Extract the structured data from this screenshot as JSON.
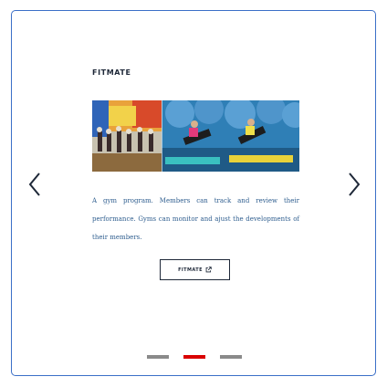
{
  "card": {
    "title": "FITMATE",
    "image_alt": "Fitness class members doing exercises with gym balls",
    "description": "A gym program. Members can track and review their performance. Gyms can monitor and ajust the developments of their members.",
    "button_label": "FITMATE",
    "button_icon": "external-link-icon"
  },
  "navigation": {
    "prev_icon": "chevron-left-icon",
    "next_icon": "chevron-right-icon"
  },
  "pagination": {
    "total": 3,
    "active_index": 1
  },
  "colors": {
    "card_border": "#3b6fc7",
    "title": "#1e2838",
    "description": "#2f5e8f",
    "dot_inactive": "#8a8a8a",
    "dot_active": "#d90000"
  }
}
